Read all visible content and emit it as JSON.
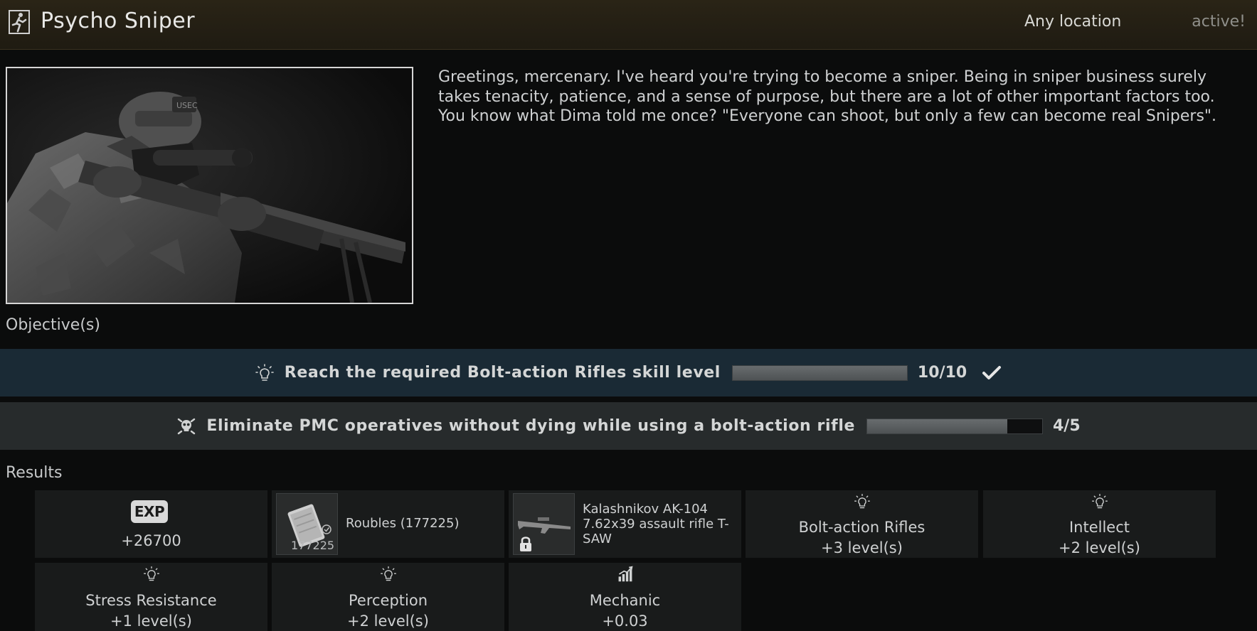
{
  "header": {
    "icon": "running-man-exit-icon",
    "title": "Psycho Sniper",
    "location": "Any location",
    "status": "active!"
  },
  "quest": {
    "image": "sniper-portrait",
    "description": "Greetings, mercenary. I've heard you're trying to become a sniper. Being in sniper business surely takes tenacity, patience, and a sense of purpose, but there are a lot of other important factors too. You know what Dima told me once? \"Everyone can shoot, but only a few can become real Snipers\"."
  },
  "objectives": {
    "title": "Objective(s)",
    "items": [
      {
        "icon": "lightbulb-icon",
        "text": "Reach the required Bolt-action Rifles skill level",
        "progress_text": "10/10",
        "progress": 1.0,
        "completed": true
      },
      {
        "icon": "skull-crossbones-icon",
        "text": "Eliminate PMC operatives without dying while using a bolt-action rifle",
        "progress_text": "4/5",
        "progress": 0.8,
        "completed": false
      }
    ]
  },
  "results": {
    "title": "Results",
    "exp": {
      "badge": "EXP",
      "value": "+26700"
    },
    "roubles": {
      "label": "Roubles (177225)",
      "count": "177225"
    },
    "weapon": {
      "label": "Kalashnikov AK-104 7.62x39 assault rifle T-SAW",
      "locked": true
    },
    "skills": [
      {
        "icon": "lightbulb-icon",
        "name": "Bolt-action Rifles",
        "value": "+3 level(s)"
      },
      {
        "icon": "lightbulb-icon",
        "name": "Intellect",
        "value": "+2 level(s)"
      },
      {
        "icon": "lightbulb-icon",
        "name": "Stress Resistance",
        "value": "+1 level(s)"
      },
      {
        "icon": "lightbulb-icon",
        "name": "Perception",
        "value": "+2 level(s)"
      },
      {
        "icon": "arm-strength-icon",
        "name": "Mechanic",
        "value": "+0.03"
      }
    ]
  },
  "colors": {
    "header_bg": "#2a2416",
    "objective_completed_bg": "#1a2a35",
    "objective_active_bg": "#272b2c",
    "reward_bg": "#191b1b"
  }
}
